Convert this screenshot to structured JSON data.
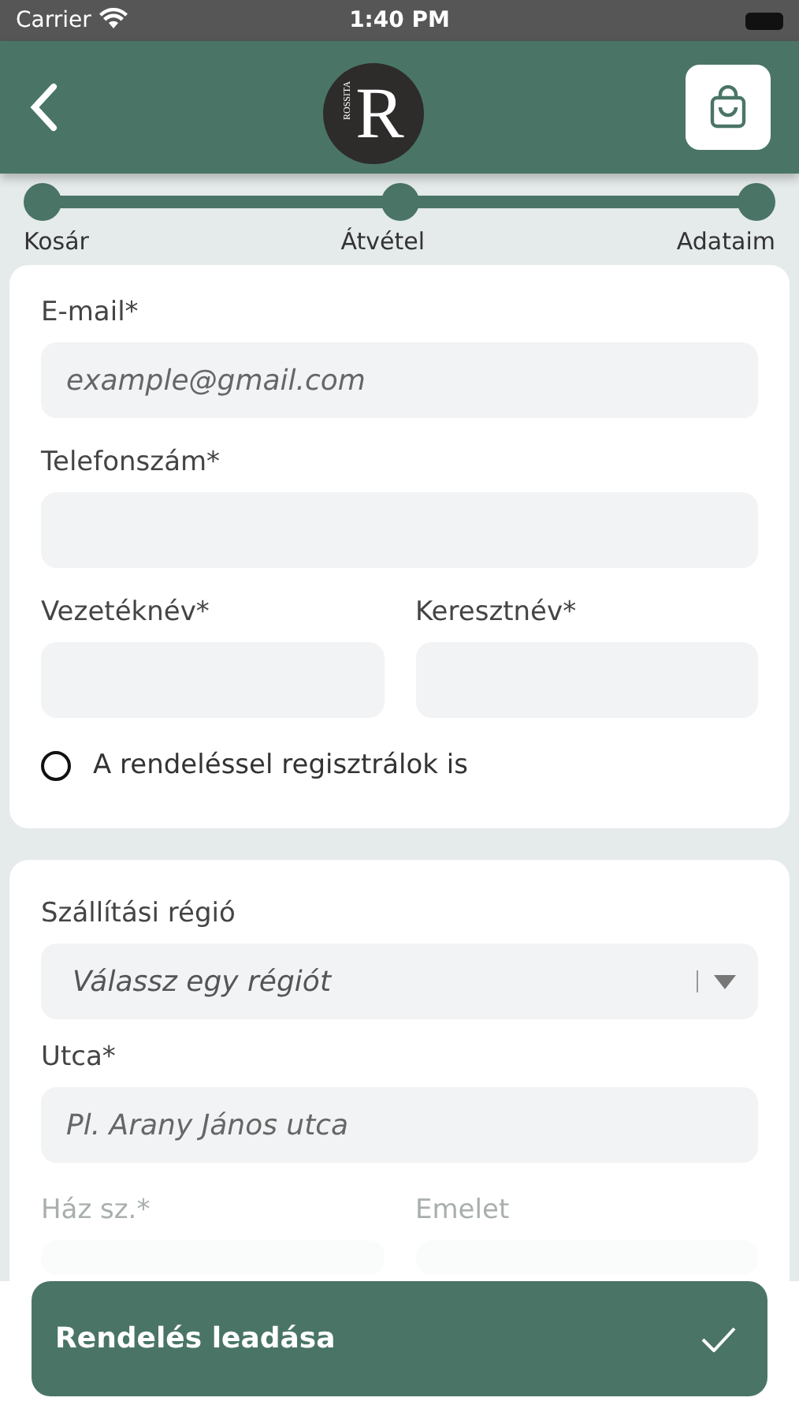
{
  "status_bar": {
    "carrier": "Carrier",
    "time": "1:40 PM"
  },
  "header": {
    "logo_letter": "R",
    "logo_text": "ROSSITA"
  },
  "steps": [
    {
      "label": "Kosár",
      "reached": true
    },
    {
      "label": "Átvétel",
      "reached": true
    },
    {
      "label": "Adataim",
      "reached": true
    }
  ],
  "contact": {
    "email": {
      "label": "E-mail*",
      "placeholder": "example@gmail.com"
    },
    "phone": {
      "label": "Telefonszám*"
    },
    "last_name": {
      "label": "Vezetéknév*"
    },
    "first_name": {
      "label": "Keresztnév*"
    },
    "register": {
      "label": "A rendeléssel regisztrálok is",
      "checked": false
    }
  },
  "shipping": {
    "region": {
      "label": "Szállítási régió",
      "placeholder": "Válassz egy régiót"
    },
    "street": {
      "label": "Utca*",
      "placeholder": "Pl. Arany János utca"
    },
    "house_number": {
      "label": "Ház sz.*"
    },
    "floor": {
      "label": "Emelet"
    }
  },
  "submit": {
    "label": "Rendelés leadása"
  }
}
